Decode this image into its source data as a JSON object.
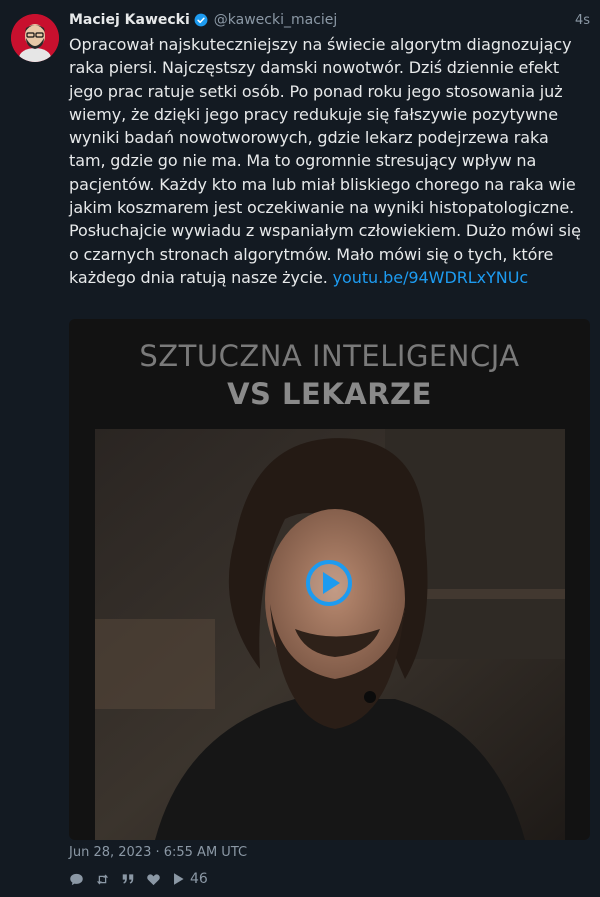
{
  "author": {
    "display_name": "Maciej Kawecki",
    "handle": "@kawecki_maciej",
    "verified": true,
    "avatar": "avatar-photo"
  },
  "time_ago": "4s",
  "text": "Opracował najskuteczniejszy na świecie algorytm diagnozujący raka piersi. Najczęstszy damski nowotwór. Dziś dziennie efekt jego prac ratuje setki osób. Po ponad roku jego stosowania już wiemy, że dzięki jego pracy redukuje się fałszywie pozytywne wyniki badań nowotworowych, gdzie lekarz podejrzewa raka tam, gdzie go nie ma. Ma to ogromnie stresujący wpływ na pacjentów. Każdy kto ma lub miał bliskiego chorego na raka wie jakim koszmarem jest oczekiwanie na wyniki histopatologiczne. Posłuchajcie wywiadu z wspaniałym człowiekiem. Dużo mówi się o czarnych stronach algorytmów. Mało mówi się o tych, które każdego dnia ratują nasze życie.",
  "link_text": "youtu.be/94WDRLxYNUc",
  "media": {
    "title_line1": "SZTUCZNA INTELIGENCJA",
    "title_line2": "VS LEKARZE",
    "play_icon": "play-circle-icon"
  },
  "timestamp": "Jun 28, 2023 · 6:55 AM UTC",
  "stats": {
    "views": "46"
  },
  "icons": {
    "reply": "comment-icon",
    "retweet": "retweet-icon",
    "quote": "quote-icon",
    "like": "heart-icon",
    "views": "play-icon"
  },
  "colors": {
    "background": "#131a22",
    "link": "#1d9bf0",
    "muted": "#8b98a5",
    "verified": "#1d9bf0"
  }
}
